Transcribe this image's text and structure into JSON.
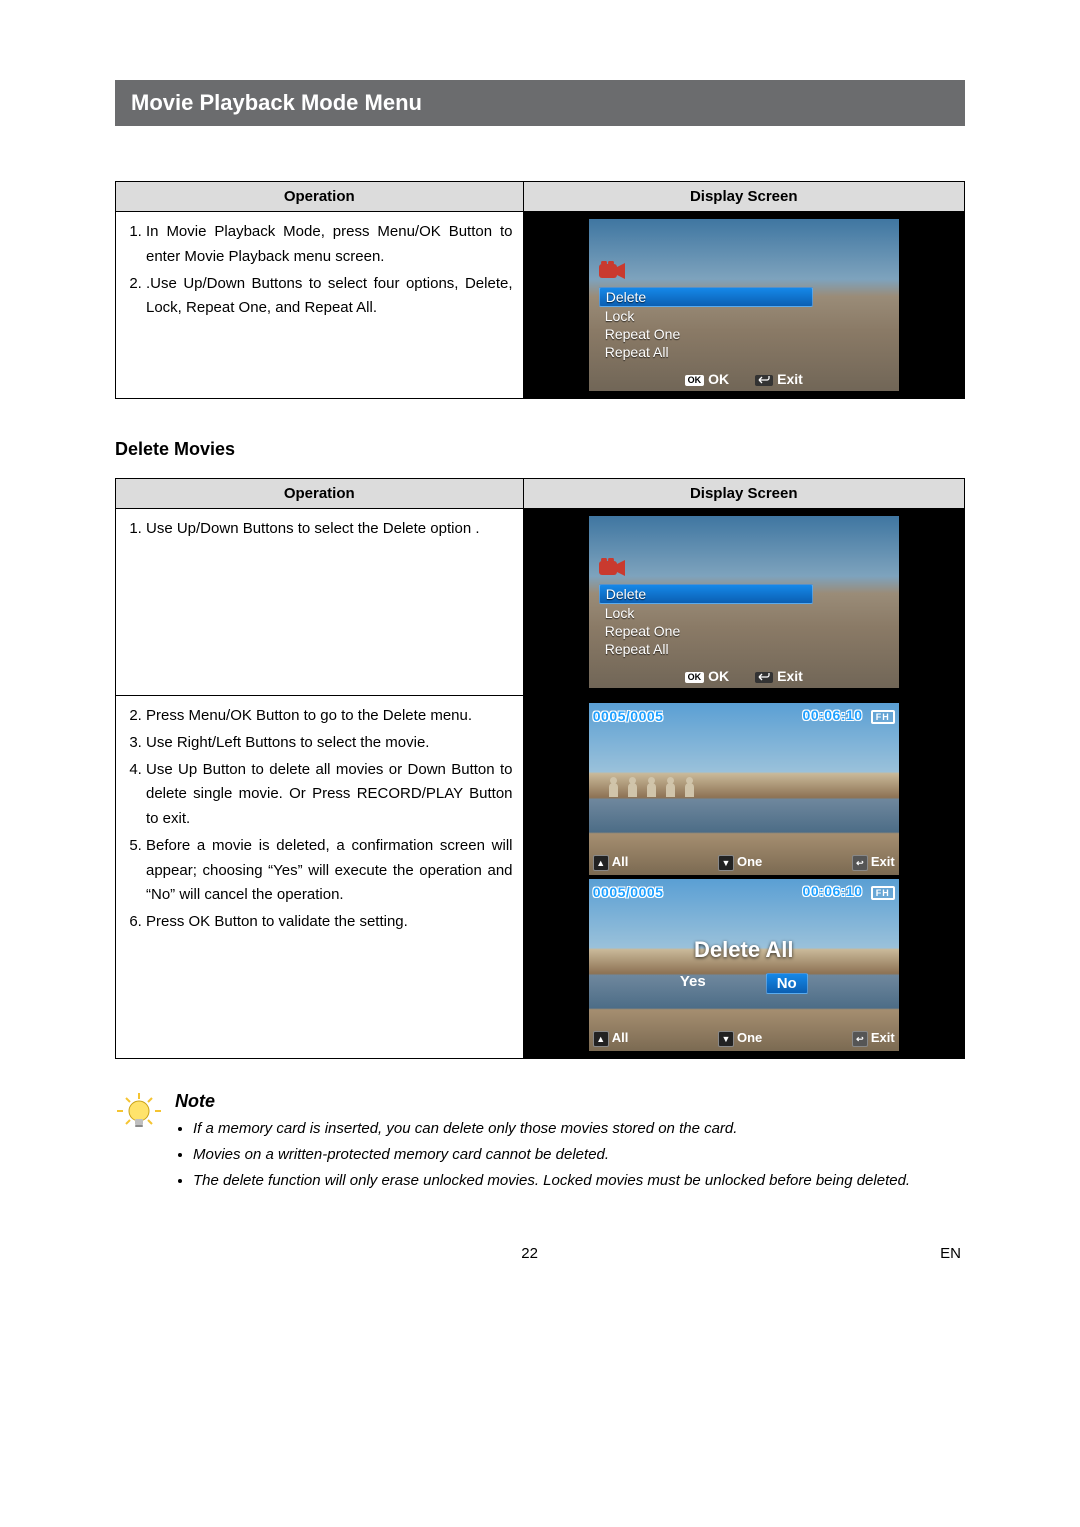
{
  "page": {
    "title": "Movie Playback Mode Menu",
    "number": "22",
    "lang": "EN"
  },
  "headers": {
    "operation": "Operation",
    "display": "Display Screen"
  },
  "table1": {
    "step1": "In Movie Playback Mode, press Menu/OK Button to enter Movie Playback menu screen.",
    "step2": ".Use Up/Down Buttons to select four options, Delete, Lock, Repeat One, and Repeat All."
  },
  "screen_menu": {
    "items": [
      "Delete",
      "Lock",
      "Repeat One",
      "Repeat  All"
    ],
    "ok_badge": "OK",
    "ok_label": "OK",
    "exit_label": "Exit"
  },
  "section2": {
    "heading": "Delete Movies"
  },
  "table2a": {
    "step1": "Use Up/Down Buttons to select the Delete option ."
  },
  "table2b": {
    "step2": "Press Menu/OK Button to go to the Delete menu.",
    "step3": "Use Right/Left Buttons to select the movie.",
    "step4": "Use Up Button to delete all movies or Down Button to delete single movie. Or Press RECORD/PLAY Button to exit.",
    "step5": "Before a movie is deleted, a confirmation screen will appear; choosing “Yes” will execute the operation and “No” will cancel the operation.",
    "step6": "Press OK Button to validate the setting."
  },
  "photo": {
    "counter": "0005/0005",
    "time": "00:06:10",
    "badge": "FH",
    "all": "All",
    "one": "One",
    "exit": "Exit",
    "delete_all": "Delete All",
    "yes": "Yes",
    "no": "No"
  },
  "note": {
    "heading": "Note",
    "b1": "If a memory card is inserted, you can delete only those movies stored on the card.",
    "b2": "Movies on a written-protected memory card cannot be deleted.",
    "b3": "The delete function will only erase unlocked movies. Locked movies must be unlocked before being deleted."
  }
}
